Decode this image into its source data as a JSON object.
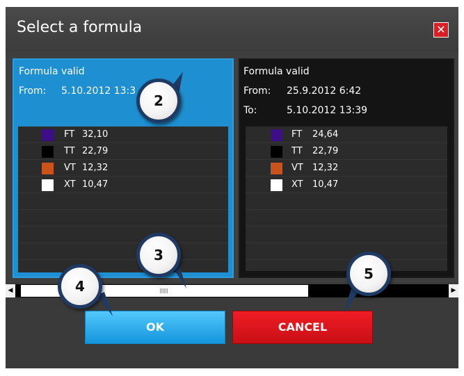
{
  "dialog": {
    "title": "Select a formula",
    "close_symbol": "✕"
  },
  "panels": [
    {
      "status": "Formula valid",
      "from_label": "From:",
      "from_value": "5.10.2012 13:3",
      "to_label": "",
      "to_value": "",
      "rows": [
        {
          "color": "#3c0f87",
          "code": "FT",
          "value": "32,10"
        },
        {
          "color": "#000000",
          "code": "TT",
          "value": "22,79"
        },
        {
          "color": "#c9531a",
          "code": "VT",
          "value": "12,32"
        },
        {
          "color": "#ffffff",
          "code": "XT",
          "value": "10,47"
        }
      ]
    },
    {
      "status": "Formula valid",
      "from_label": "From:",
      "from_value": "25.9.2012 6:42",
      "to_label": "To:",
      "to_value": "5.10.2012 13:39",
      "rows": [
        {
          "color": "#3c0f87",
          "code": "FT",
          "value": "24,64"
        },
        {
          "color": "#000000",
          "code": "TT",
          "value": "22,79"
        },
        {
          "color": "#c9531a",
          "code": "VT",
          "value": "12,32"
        },
        {
          "color": "#ffffff",
          "code": "XT",
          "value": "10,47"
        }
      ]
    }
  ],
  "scrollbar": {
    "left_arrow": "◀",
    "right_arrow": "▶"
  },
  "buttons": {
    "ok_label": "OK",
    "cancel_label": "CANCEL"
  },
  "callouts": [
    "2",
    "3",
    "4",
    "5"
  ]
}
